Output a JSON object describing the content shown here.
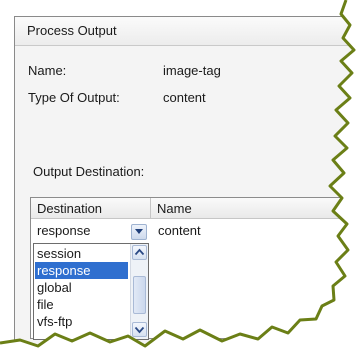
{
  "panel": {
    "title": "Process Output"
  },
  "fields": {
    "name_label": "Name:",
    "name_value": "image-tag",
    "type_label": "Type Of Output:",
    "type_value": "content"
  },
  "section": {
    "output_destination_label": "Output Destination:"
  },
  "table": {
    "headers": [
      "Destination",
      "Name"
    ],
    "row": {
      "destination": "response",
      "name": "content"
    }
  },
  "dropdown": {
    "options": [
      "session",
      "response",
      "global",
      "file",
      "vfs-ftp"
    ],
    "selected": "response"
  },
  "colors": {
    "selection": "#2f6fcf",
    "torn_edge": "#6b7f16"
  },
  "icons": {
    "dropdown": "chevron-down-icon",
    "scroll_up": "chevron-up-icon",
    "scroll_down": "chevron-down-icon"
  }
}
